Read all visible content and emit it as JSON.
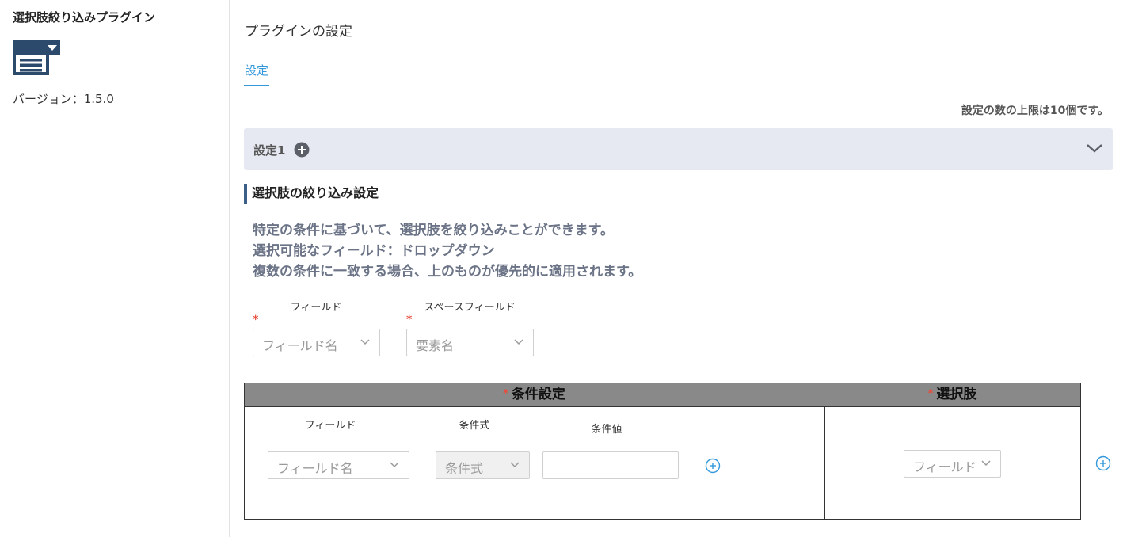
{
  "sidebar": {
    "plugin_name": "選択肢絞り込みプラグイン",
    "version": "バージョン：1.5.0",
    "icon": "dropdown-list-icon"
  },
  "header": {
    "page_title": "プラグインの設定",
    "tabs": [
      {
        "label": "設定",
        "active": true
      }
    ],
    "limit_note": "設定の数の上限は10個です。"
  },
  "setting": {
    "title": "設定1",
    "add_icon": "plus-circle-icon",
    "collapse_icon": "chevron-down-icon",
    "section_heading": "選択肢の絞り込み設定",
    "description": [
      "特定の条件に基づいて、選択肢を絞り込みことができます。",
      "選択可能なフィールド：ドロップダウン",
      "複数の条件に一致する場合、上のものが優先的に適用されます。"
    ],
    "required_mark": "*",
    "field": {
      "label": "フィールド",
      "placeholder": "フィールド名"
    },
    "space_field": {
      "label": "スペースフィールド",
      "placeholder": "要素名"
    }
  },
  "table": {
    "condition_header": "条件設定",
    "choice_header": "選択肢",
    "required_mark": "*",
    "columns": {
      "field": "フィールド",
      "operator": "条件式",
      "value": "条件値"
    },
    "field_placeholder": "フィールド名",
    "operator_placeholder": "条件式",
    "value_input": "",
    "choice_placeholder": "フィールド"
  },
  "colors": {
    "accent": "#3498db",
    "required": "#e74c3c",
    "header_bg": "#e6e9f1",
    "table_header_bg": "#898989",
    "description_text": "#6b7386"
  }
}
